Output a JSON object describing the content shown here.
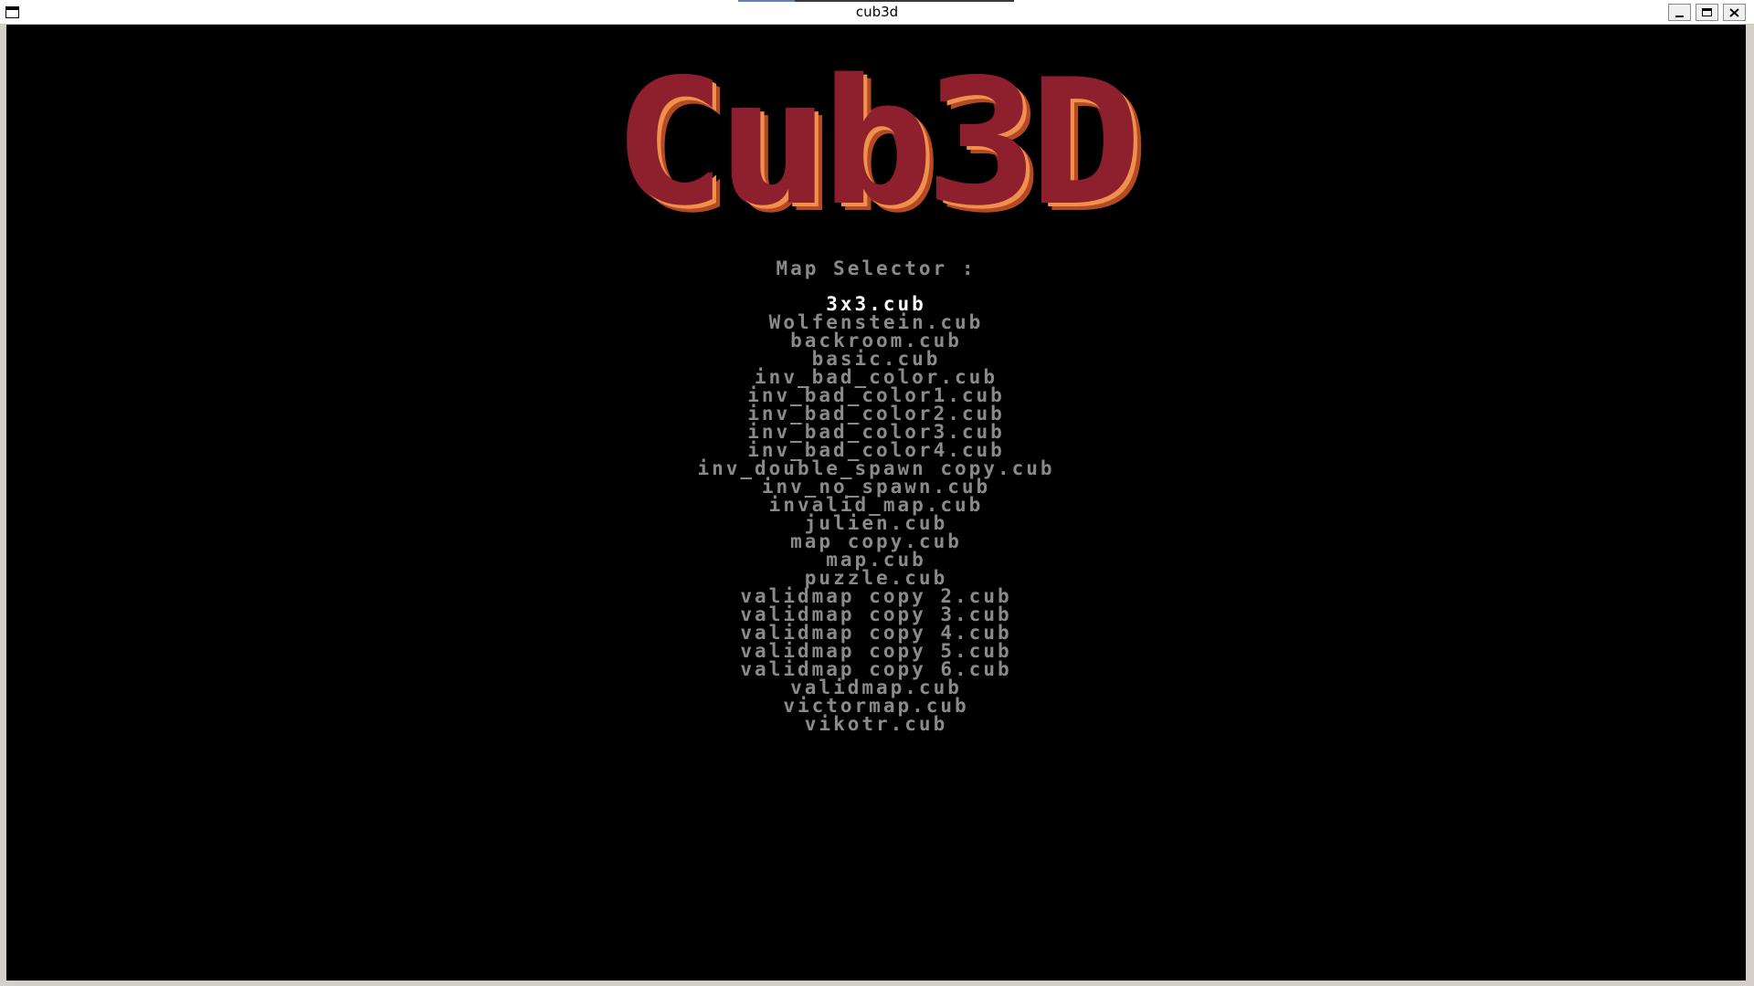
{
  "window": {
    "title": "cub3d"
  },
  "game": {
    "logo_text": "Cub3D",
    "menu_title": "Map Selector :",
    "selected_index": 0,
    "colors": {
      "background": "#000000",
      "logo_main": "#8e1f2c",
      "logo_shadow_light": "#f0904c",
      "logo_shadow_dark": "#b34a24",
      "item_text": "#8a8a8a",
      "item_selected": "#ffffff"
    },
    "maps": [
      "3x3.cub",
      "Wolfenstein.cub",
      "backroom.cub",
      "basic.cub",
      "inv_bad_color.cub",
      "inv_bad_color1.cub",
      "inv_bad_color2.cub",
      "inv_bad_color3.cub",
      "inv_bad_color4.cub",
      "inv_double_spawn copy.cub",
      "inv_no_spawn.cub",
      "invalid_map.cub",
      "julien.cub",
      "map copy.cub",
      "map.cub",
      "puzzle.cub",
      "validmap copy 2.cub",
      "validmap copy 3.cub",
      "validmap copy 4.cub",
      "validmap copy 5.cub",
      "validmap copy 6.cub",
      "validmap.cub",
      "victormap.cub",
      "vikotr.cub"
    ]
  }
}
